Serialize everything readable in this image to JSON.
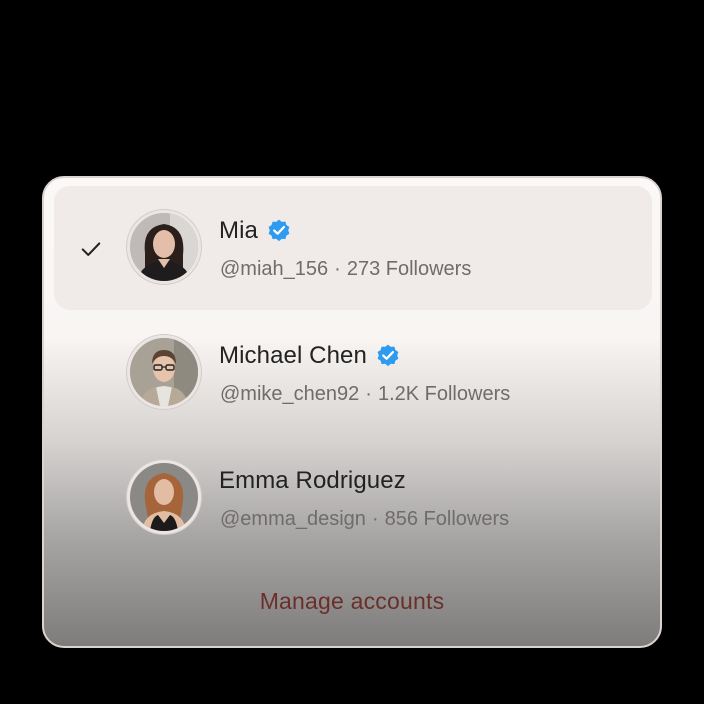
{
  "accounts": [
    {
      "name": "Mia",
      "handle": "@miah_156",
      "separator": "·",
      "followers": "273 Followers",
      "verified": true,
      "selected": true,
      "avatar_icon": "avatar-photo-mia"
    },
    {
      "name": "Michael Chen",
      "handle": "@mike_chen92",
      "separator": "·",
      "followers": "1.2K Followers",
      "verified": true,
      "selected": false,
      "avatar_icon": "avatar-photo-michael"
    },
    {
      "name": "Emma Rodriguez",
      "handle": "@emma_design",
      "separator": "·",
      "followers": "856 Followers",
      "verified": false,
      "selected": false,
      "avatar_icon": "avatar-photo-emma"
    }
  ],
  "manage_label": "Manage accounts",
  "icons": {
    "selected": "checkmark-icon",
    "verified": "verified-badge-icon"
  },
  "colors": {
    "verified": "#2c9bf0",
    "manage_link": "#6a2f2a",
    "selected_row": "#f0ebe9"
  }
}
